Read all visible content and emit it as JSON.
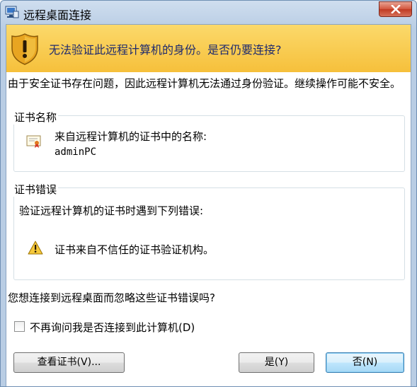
{
  "window": {
    "title": "远程桌面连接"
  },
  "banner": {
    "text": "无法验证此远程计算机的身份。是否仍要连接?"
  },
  "description": "由于安全证书存在问题，因此远程计算机无法通过身份验证。继续操作可能不安全。",
  "cert_name_group": {
    "label": "证书名称",
    "line1": "来自远程计算机的证书中的名称:",
    "line2": "adminPC"
  },
  "cert_error_group": {
    "label": "证书错误",
    "line1": "验证远程计算机的证书时遇到下列错误:",
    "line2": "证书来自不信任的证书验证机构。"
  },
  "question": "您想连接到远程桌面而忽略这些证书错误吗?",
  "checkbox": {
    "label": "不再询问我是否连接到此计算机(D)",
    "checked": false
  },
  "buttons": {
    "view_cert": "查看证书(V)...",
    "yes": "是(Y)",
    "no": "否(N)"
  },
  "icons": {
    "app": "remote-desktop-icon",
    "close": "close-icon",
    "banner": "warning-shield-icon",
    "cert": "certificate-icon",
    "warn": "warning-triangle-icon"
  }
}
